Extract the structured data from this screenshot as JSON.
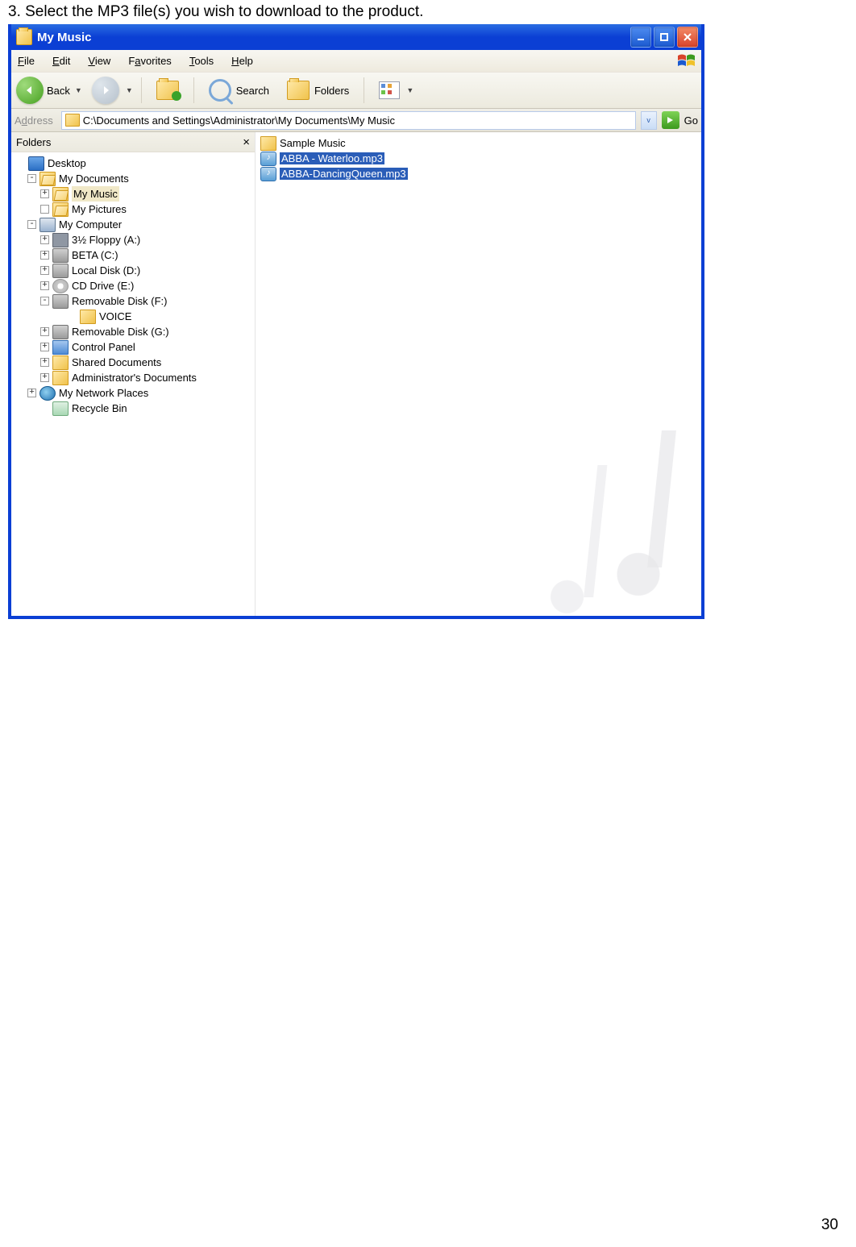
{
  "instruction": "3. Select the MP3 file(s) you wish to download to the product.",
  "window_title": "My Music",
  "menu": {
    "items": [
      "File",
      "Edit",
      "View",
      "Favorites",
      "Tools",
      "Help"
    ]
  },
  "toolbar": {
    "back": "Back",
    "search": "Search",
    "folders": "Folders"
  },
  "address": {
    "label": "Address",
    "path": "C:\\Documents and Settings\\Administrator\\My Documents\\My Music",
    "go": "Go"
  },
  "folders_header": "Folders",
  "tree": [
    {
      "ind": 0,
      "exp": "",
      "ico": "desktop",
      "label": "Desktop"
    },
    {
      "ind": 1,
      "exp": "-",
      "ico": "folder-open",
      "label": "My Documents"
    },
    {
      "ind": 2,
      "exp": "+",
      "ico": "folder-open",
      "label": "My Music",
      "sel": true
    },
    {
      "ind": 2,
      "exp": "b",
      "ico": "folder-open",
      "label": "My Pictures"
    },
    {
      "ind": 1,
      "exp": "-",
      "ico": "comp",
      "label": "My Computer"
    },
    {
      "ind": 2,
      "exp": "+",
      "ico": "floppy",
      "label": "3½ Floppy (A:)"
    },
    {
      "ind": 2,
      "exp": "+",
      "ico": "drive",
      "label": "BETA (C:)"
    },
    {
      "ind": 2,
      "exp": "+",
      "ico": "drive",
      "label": "Local Disk (D:)"
    },
    {
      "ind": 2,
      "exp": "+",
      "ico": "cd",
      "label": "CD Drive (E:)"
    },
    {
      "ind": 2,
      "exp": "-",
      "ico": "drive",
      "label": "Removable Disk (F:)"
    },
    {
      "ind": 4,
      "exp": "",
      "ico": "folder",
      "label": "VOICE"
    },
    {
      "ind": 2,
      "exp": "+",
      "ico": "drive",
      "label": "Removable Disk (G:)"
    },
    {
      "ind": 2,
      "exp": "+",
      "ico": "cp",
      "label": "Control Panel"
    },
    {
      "ind": 2,
      "exp": "+",
      "ico": "folder",
      "label": "Shared Documents"
    },
    {
      "ind": 2,
      "exp": "+",
      "ico": "folder",
      "label": "Administrator's Documents"
    },
    {
      "ind": 1,
      "exp": "+",
      "ico": "net",
      "label": "My Network Places"
    },
    {
      "ind": 2,
      "exp": "",
      "ico": "bin",
      "label": "Recycle Bin"
    }
  ],
  "list": [
    {
      "ico": "folder",
      "label": "Sample Music",
      "sel": false
    },
    {
      "ico": "music",
      "label": "ABBA - Waterloo.mp3",
      "sel": true
    },
    {
      "ico": "music",
      "label": "ABBA-DancingQueen.mp3",
      "sel": true
    }
  ],
  "page_number": "30"
}
